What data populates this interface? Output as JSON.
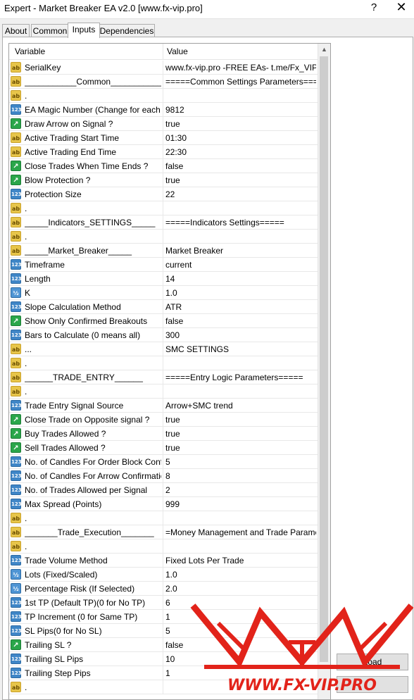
{
  "window": {
    "title": "Expert - Market Breaker EA v2.0 [www.fx-vip.pro]",
    "help": "?",
    "close": "✕"
  },
  "tabs": [
    "About",
    "Common",
    "Inputs",
    "Dependencies"
  ],
  "active_tab": "Inputs",
  "grid": {
    "col_variable": "Variable",
    "col_value": "Value",
    "rows": [
      {
        "icon": "ab",
        "var": "SerialKey",
        "val": "www.fx-vip.pro   -FREE EAs-   t.me/Fx_VIP"
      },
      {
        "icon": "ab",
        "var": "___________Common___________",
        "val": "=====Common Settings Parameters====="
      },
      {
        "icon": "ab",
        "var": ".",
        "val": ""
      },
      {
        "icon": "123",
        "var": "EA Magic Number (Change for each C...",
        "val": "9812"
      },
      {
        "icon": "bool",
        "var": "Draw Arrow on Signal ?",
        "val": "true"
      },
      {
        "icon": "ab",
        "var": "Active Trading Start Time",
        "val": "01:30"
      },
      {
        "icon": "ab",
        "var": "Active Trading End Time",
        "val": "22:30"
      },
      {
        "icon": "bool",
        "var": "Close Trades When Time Ends ?",
        "val": "false"
      },
      {
        "icon": "bool",
        "var": "Blow Protection ?",
        "val": "true"
      },
      {
        "icon": "123",
        "var": "Protection Size",
        "val": "22"
      },
      {
        "icon": "ab",
        "var": ".",
        "val": ""
      },
      {
        "icon": "ab",
        "var": "_____Indicators_SETTINGS_____",
        "val": "=====Indicators Settings====="
      },
      {
        "icon": "ab",
        "var": ".",
        "val": ""
      },
      {
        "icon": "ab",
        "var": "_____Market_Breaker_____",
        "val": "Market Breaker"
      },
      {
        "icon": "123",
        "var": "Timeframe",
        "val": "current"
      },
      {
        "icon": "123",
        "var": "Length",
        "val": "14"
      },
      {
        "icon": "frac",
        "var": "K",
        "val": "1.0"
      },
      {
        "icon": "123",
        "var": "Slope Calculation Method",
        "val": "ATR"
      },
      {
        "icon": "bool",
        "var": "Show Only Confirmed Breakouts",
        "val": "false"
      },
      {
        "icon": "123",
        "var": "Bars to Calculate (0 means all)",
        "val": "300"
      },
      {
        "icon": "ab",
        "var": "...",
        "val": "SMC SETTINGS"
      },
      {
        "icon": "ab",
        "var": ".",
        "val": ""
      },
      {
        "icon": "ab",
        "var": "______TRADE_ENTRY______",
        "val": "=====Entry Logic Parameters====="
      },
      {
        "icon": "ab",
        "var": ".",
        "val": ""
      },
      {
        "icon": "123",
        "var": "Trade Entry Signal Source",
        "val": "Arrow+SMC trend"
      },
      {
        "icon": "bool",
        "var": "Close Trade on Opposite signal ?",
        "val": "true"
      },
      {
        "icon": "bool",
        "var": "Buy Trades Allowed ?",
        "val": "true"
      },
      {
        "icon": "bool",
        "var": "Sell Trades Allowed ?",
        "val": "true"
      },
      {
        "icon": "123",
        "var": "No. of Candles For Order Block Confir...",
        "val": "5"
      },
      {
        "icon": "123",
        "var": "No. of Candles For Arrow Confirmation",
        "val": "8"
      },
      {
        "icon": "123",
        "var": "No. of Trades Allowed per Signal",
        "val": "2"
      },
      {
        "icon": "123",
        "var": "Max Spread (Points)",
        "val": "999"
      },
      {
        "icon": "ab",
        "var": ".",
        "val": ""
      },
      {
        "icon": "ab",
        "var": "_______Trade_Execution_______",
        "val": "=Money Management and Trade Paramet..."
      },
      {
        "icon": "ab",
        "var": ".",
        "val": ""
      },
      {
        "icon": "123",
        "var": "Trade Volume Method",
        "val": "Fixed Lots Per Trade"
      },
      {
        "icon": "frac",
        "var": "Lots (Fixed/Scaled)",
        "val": "1.0"
      },
      {
        "icon": "frac",
        "var": "Percentage Risk (If Selected)",
        "val": "2.0"
      },
      {
        "icon": "123",
        "var": "1st TP (Default TP)(0 for No TP)",
        "val": "6"
      },
      {
        "icon": "123",
        "var": "TP Increment (0 for Same TP)",
        "val": "1"
      },
      {
        "icon": "123",
        "var": "SL Pips(0 for No SL)",
        "val": "5"
      },
      {
        "icon": "bool",
        "var": "Trailing SL ?",
        "val": "false"
      },
      {
        "icon": "123",
        "var": "Trailing SL Pips",
        "val": "10"
      },
      {
        "icon": "123",
        "var": "Trailing Step Pips",
        "val": "1"
      },
      {
        "icon": "ab",
        "var": ".",
        "val": ""
      }
    ]
  },
  "icon_glyphs": {
    "ab": "ab",
    "123": "123",
    "frac": "½",
    "bool": "↗"
  },
  "buttons": {
    "load": "Load"
  },
  "watermark": {
    "text": "WWW.FX-VIP.PRO",
    "color": "#e2231a"
  }
}
